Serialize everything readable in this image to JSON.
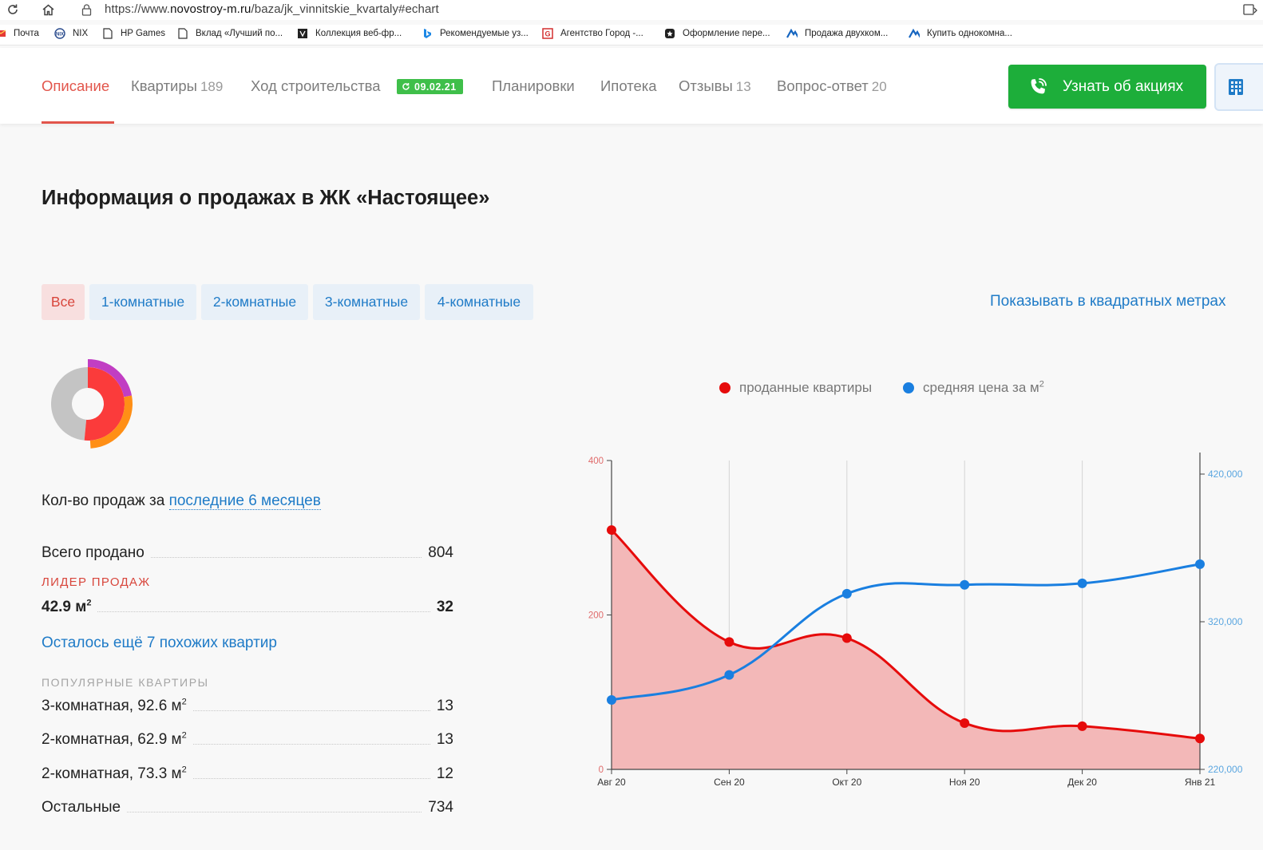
{
  "browser": {
    "url_prefix": "https://www.",
    "url_domain": "novostroy-m.ru",
    "url_path": "/baza/jk_vinnitskie_kvartaly#echart",
    "bookmarks": [
      "Почта",
      "NIX",
      "HP Games",
      "Вклад «Лучший по...",
      "Коллекция веб-фр...",
      "Рекомендуемые уз...",
      "Агентство Город -...",
      "Оформление пере...",
      "Продажа двухком...",
      "Купить однокомна..."
    ],
    "bookmark_icons": [
      "mail-icon",
      "nix-icon",
      "page-icon",
      "page-icon",
      "collection-icon",
      "bing-icon",
      "gorod-icon",
      "star-icon",
      "avito-icon",
      "avito-icon"
    ]
  },
  "nav": {
    "tabs": [
      {
        "label": "Описание",
        "count": ""
      },
      {
        "label": "Квартиры",
        "count": "189"
      },
      {
        "label": "Ход строительства",
        "count": ""
      },
      {
        "label": "Планировки",
        "count": ""
      },
      {
        "label": "Ипотека",
        "count": ""
      },
      {
        "label": "Отзывы",
        "count": "13"
      },
      {
        "label": "Вопрос-ответ",
        "count": "20"
      }
    ],
    "construction_date": "09.02.21",
    "cta_label": "Узнать об акциях",
    "accent": "#e2554b",
    "cta_color": "#1dae3a"
  },
  "sales": {
    "title": "Информация о продажах в ЖК «Настоящее»",
    "filters": [
      "Все",
      "1-комнатные",
      "2-комнатные",
      "3-комнатные",
      "4-комнатные"
    ],
    "sqm_toggle": "Показывать в квадратных метрах",
    "period_prefix": "Кол-во продаж за",
    "period_link": "последние 6 месяцев",
    "total_label": "Всего продано",
    "total_value": "804",
    "leader_caption": "ЛИДЕР ПРОДАЖ",
    "leader_label": "42.9 м",
    "leader_sup": "2",
    "leader_value": "32",
    "more_link": "Осталось ещё 7 похожих квартир",
    "popular_caption": "ПОПУЛЯРНЫЕ КВАРТИРЫ",
    "popular": [
      {
        "label": "3-комнатная, 92.6 м",
        "sup": "2",
        "value": "13"
      },
      {
        "label": "2-комнатная, 62.9 м",
        "sup": "2",
        "value": "13"
      },
      {
        "label": "2-комнатная, 73.3 м",
        "sup": "2",
        "value": "12"
      }
    ],
    "rest_label": "Остальные",
    "rest_value": "734",
    "donut": {
      "inner": [
        {
          "name": "Остальные",
          "value": 734,
          "color": "#c4c4c4"
        },
        {
          "name": "3-комнатная, 92.6 м2",
          "value": 13,
          "color": "#fb3b3b"
        },
        {
          "name": "2-комнатная, 62.9 м2",
          "value": 13,
          "color": "#fb3b3b"
        },
        {
          "name": "2-комнатная, 73.3 м2",
          "value": 12,
          "color": "#fb3b3b"
        },
        {
          "name": "42.9 м2",
          "value": 32,
          "color": "#fb3b3b"
        }
      ],
      "outer": [
        {
          "value": 1,
          "color": "#c13ec3"
        },
        {
          "value": 1.15,
          "color": "#ff8f16"
        }
      ]
    }
  },
  "chart_data": {
    "type": "line",
    "categories": [
      "Авг 20",
      "Сен 20",
      "Окт 20",
      "Ноя 20",
      "Дек 20",
      "Янв 21"
    ],
    "series": [
      {
        "name": "проданные квартиры",
        "axis": "left",
        "values": [
          310,
          165,
          170,
          60,
          56,
          40
        ],
        "color": "#e60b0b",
        "fill": "#f3b8b8",
        "style": "area"
      },
      {
        "name": "средняя цена за м",
        "name_sup": "2",
        "axis": "right",
        "values": [
          267000,
          284000,
          339000,
          345000,
          346000,
          359000
        ],
        "color": "#1a7fe0",
        "style": "line"
      }
    ],
    "y_left": {
      "min": 0,
      "max": 400,
      "ticks": [
        "0",
        "200",
        "400"
      ],
      "color": "#e06b6b"
    },
    "y_right": {
      "min": 220000,
      "max": 430000,
      "ticks": [
        "220,000",
        "320,000",
        "420,000"
      ],
      "color": "#5aa6e0"
    },
    "grid": "vertical"
  }
}
